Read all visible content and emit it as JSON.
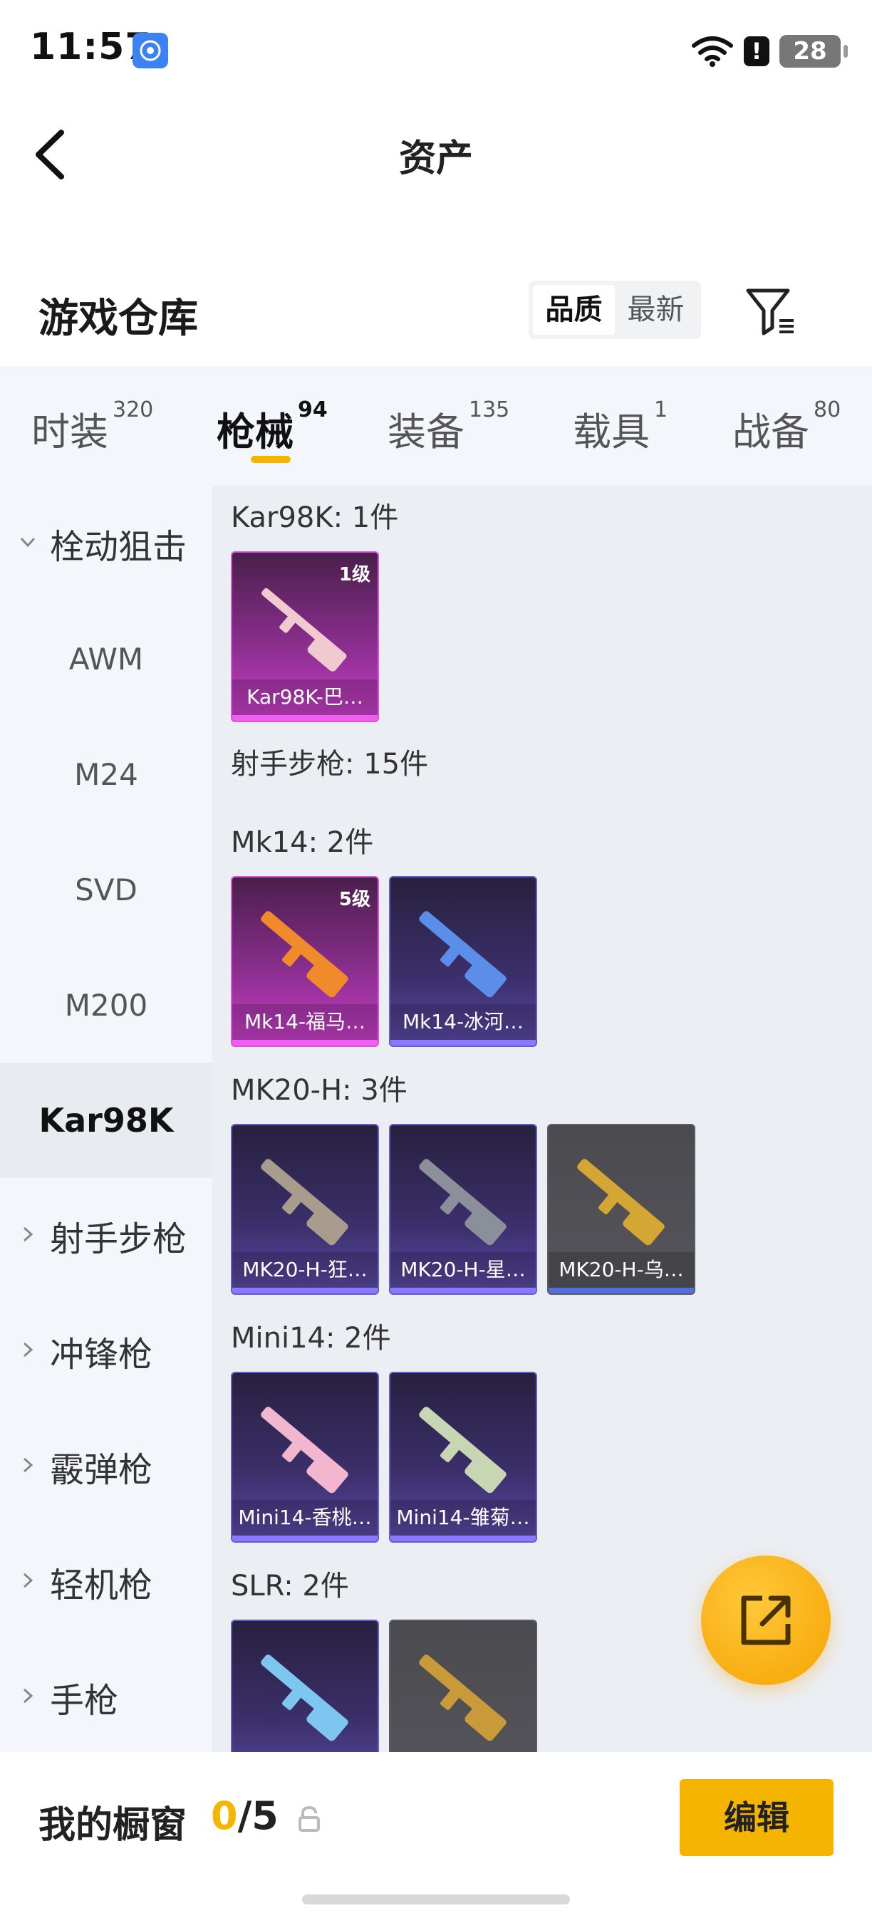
{
  "status_bar": {
    "time": "11:57",
    "battery": "28",
    "alert": "!"
  },
  "header": {
    "title": "资产"
  },
  "warehouse": {
    "title": "游戏仓库",
    "sort_options": [
      "品质",
      "最新"
    ],
    "active_sort": "品质"
  },
  "tabs": [
    {
      "label": "时装",
      "count": "320"
    },
    {
      "label": "枪械",
      "count": "94"
    },
    {
      "label": "装备",
      "count": "135"
    },
    {
      "label": "载具",
      "count": "1"
    },
    {
      "label": "战备",
      "count": "80"
    }
  ],
  "sidenav": {
    "expanded_category": "栓动狙击",
    "sub_items": [
      "AWM",
      "M24",
      "SVD",
      "M200",
      "Kar98K"
    ],
    "selected": "Kar98K",
    "categories": [
      "射手步枪",
      "冲锋枪",
      "霰弹枪",
      "轻机枪",
      "手枪"
    ]
  },
  "content": {
    "groups": [
      {
        "title": "Kar98K: 1件"
      },
      {
        "title": "射手步枪: 15件"
      },
      {
        "title": "Mk14: 2件"
      },
      {
        "title": "MK20-H: 3件"
      },
      {
        "title": "Mini14: 2件"
      },
      {
        "title": "SLR: 2件"
      }
    ],
    "items": [
      {
        "name": "Kar98K-巴…",
        "level": "1级",
        "rarity": "pink",
        "gun_color": "#f1c9d0"
      },
      {
        "name": "Mk14-福马…",
        "level": "5级",
        "rarity": "pink",
        "gun_color": "#f08a2a"
      },
      {
        "name": "Mk14-冰河…",
        "level": "",
        "rarity": "purple",
        "gun_color": "#5b8ee8"
      },
      {
        "name": "MK20-H-狂…",
        "level": "",
        "rarity": "purple",
        "gun_color": "#a89c8c"
      },
      {
        "name": "MK20-H-星…",
        "level": "",
        "rarity": "purple",
        "gun_color": "#8a8f99"
      },
      {
        "name": "MK20-H-乌…",
        "level": "",
        "rarity": "gray",
        "gun_color": "#d4a634"
      },
      {
        "name": "Mini14-香桃…",
        "level": "",
        "rarity": "purple",
        "gun_color": "#f2b6cf"
      },
      {
        "name": "Mini14-雏菊…",
        "level": "",
        "rarity": "purple",
        "gun_color": "#c9d6b4"
      },
      {
        "name": "",
        "level": "",
        "rarity": "purple",
        "gun_color": "#7cc6f0"
      },
      {
        "name": "",
        "level": "",
        "rarity": "gray",
        "gun_color": "#c99a3a"
      }
    ]
  },
  "showcase": {
    "label": "我的橱窗",
    "used": "0",
    "total": "/5"
  },
  "actions": {
    "edit_label": "编辑"
  },
  "colors": {
    "accent": "#f5b400",
    "sidebar_bg": "#f3f7fc",
    "content_bg": "#ebeef3"
  }
}
